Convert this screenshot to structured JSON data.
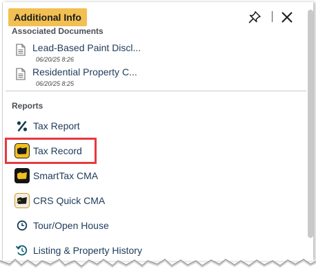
{
  "header": {
    "title": "Additional Info"
  },
  "documents": {
    "title": "Associated Documents",
    "items": [
      {
        "name": "Lead-Based Paint Discl...",
        "date": "06/20/25 8:26"
      },
      {
        "name": "Residential Property C...",
        "date": "06/20/25 8:25"
      }
    ]
  },
  "reports": {
    "title": "Reports",
    "items": [
      {
        "label": "Tax Report",
        "icon": "percent-icon"
      },
      {
        "label": "Tax Record",
        "icon": "tax-record-icon"
      },
      {
        "label": "SmartTax CMA",
        "icon": "smarttax-icon"
      },
      {
        "label": "CRS Quick CMA",
        "icon": "crs-icon"
      },
      {
        "label": "Tour/Open House",
        "icon": "clock-icon"
      },
      {
        "label": "Listing & Property History",
        "icon": "history-icon"
      }
    ]
  },
  "colors": {
    "header_tab": "#f2bf52",
    "highlight": "#e9383f",
    "link_text": "#1d3a5a"
  }
}
